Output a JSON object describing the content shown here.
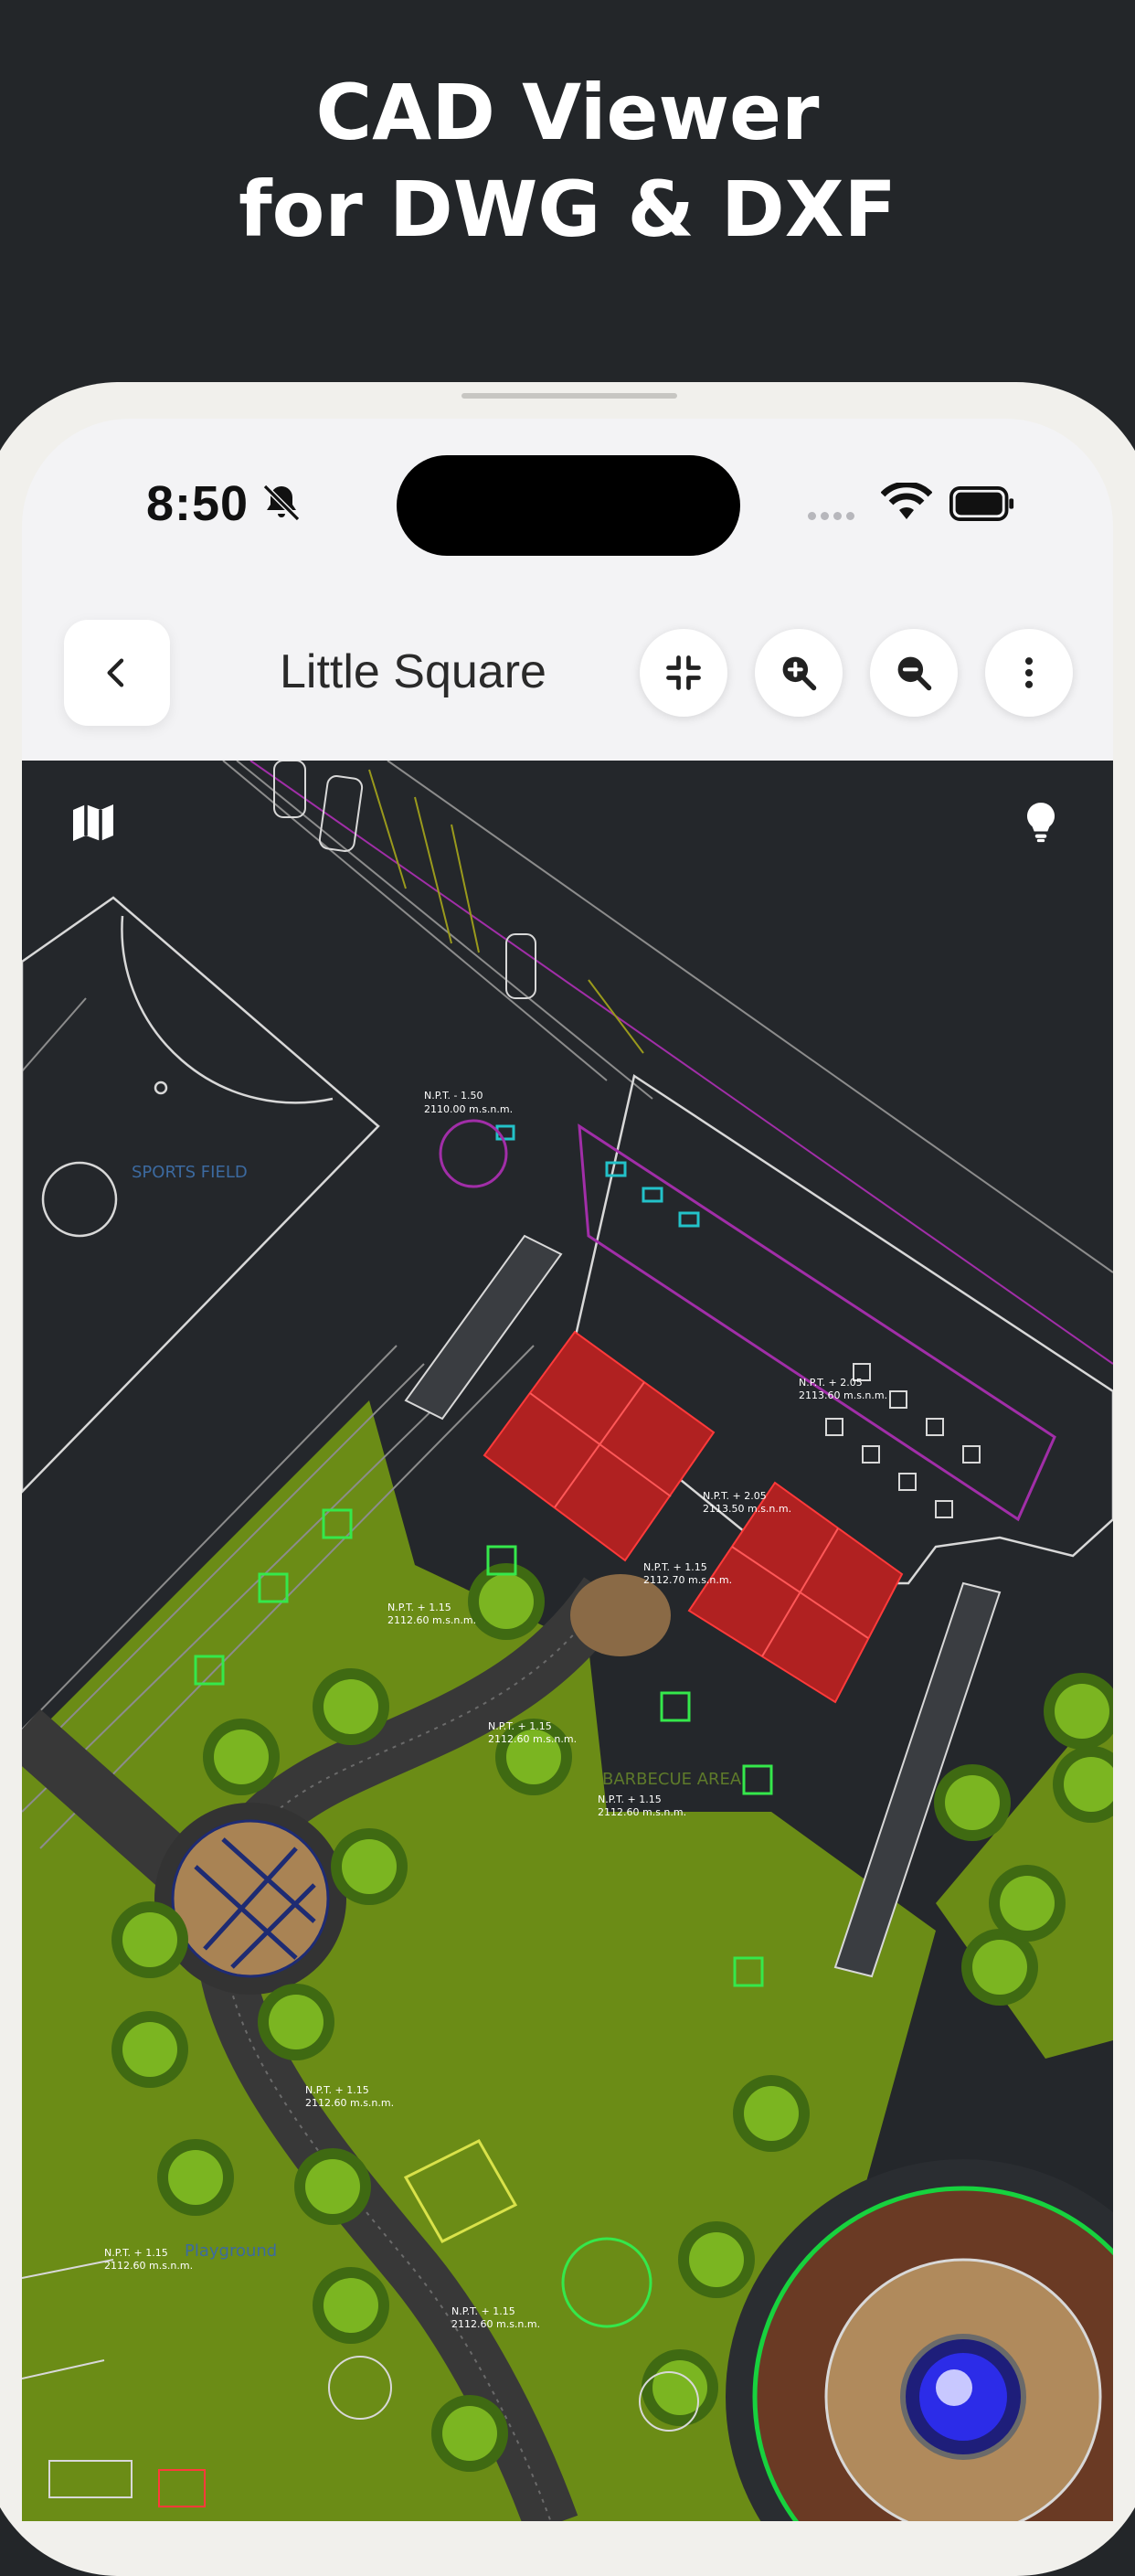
{
  "hero": {
    "line1": "CAD Viewer",
    "line2": "for DWG & DXF"
  },
  "status_bar": {
    "time": "8:50"
  },
  "toolbar": {
    "title": "Little Square"
  },
  "drawing": {
    "labels": {
      "sports_field": "SPORTS FIELD",
      "barbecue_area": "BARBECUE AREA",
      "playground": "Playground",
      "level_1": "N.P.T. - 1.50",
      "level_1_val": "2110.00 m.s.n.m.",
      "level_2": "N.P.T. + 2.05",
      "level_2_val": "2113.60 m.s.n.m.",
      "level_3": "N.P.T. + 2.05",
      "level_3_val": "2113.50 m.s.n.m.",
      "level_4": "N.P.T. + 1.15",
      "level_4_val": "2112.70 m.s.n.m.",
      "level_5": "N.P.T. + 1.15",
      "level_5_val": "2112.60 m.s.n.m.",
      "level_6": "N.P.T. + 1.15",
      "level_6_val": "2112.60 m.s.n.m.",
      "level_7": "N.P.T. + 1.15",
      "level_7_val": "2112.60 m.s.n.m.",
      "level_8": "N.P.T. + 1.15",
      "level_8_val": "2112.60 m.s.n.m.",
      "level_9": "N.P.T. + 1.15",
      "level_9_val": "2112.60 m.s.n.m.",
      "level_10": "N.P.T. + 1.15",
      "level_10_val": "2112.60 m.s.n.m."
    }
  },
  "colors": {
    "background": "#232629",
    "canvas": "#24272b",
    "lawn": "#6b8c16",
    "roof": "#b02121",
    "accent": "#ffffff"
  },
  "icons": {
    "back": "chevron-left-icon",
    "fit": "compress-icon",
    "zoom_in": "zoom-in-icon",
    "zoom_out": "zoom-out-icon",
    "more": "more-vertical-icon",
    "map": "map-icon",
    "light": "lightbulb-icon"
  }
}
